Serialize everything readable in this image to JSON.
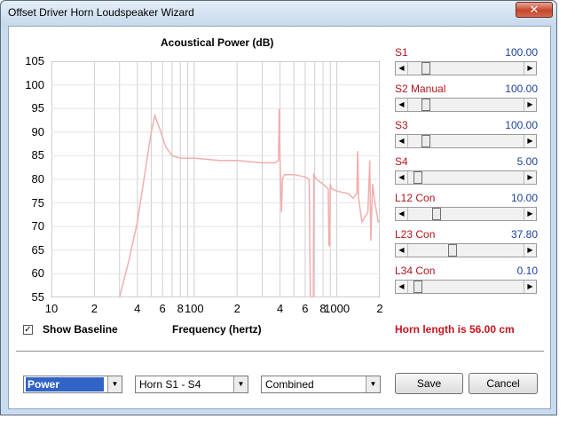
{
  "window": {
    "title": "Offset Driver Horn Loudspeaker Wizard",
    "close_glyph": "✕"
  },
  "chart_data": {
    "type": "line",
    "title": "Acoustical Power (dB)",
    "xlabel": "Frequency (hertz)",
    "ylabel": "",
    "x_scale": "log",
    "xlim": [
      10,
      2000
    ],
    "ylim": [
      55,
      105
    ],
    "yticks": [
      "105",
      "100",
      "95",
      "90",
      "85",
      "80",
      "75",
      "70",
      "65",
      "60",
      "55"
    ],
    "xticks": [
      "10",
      "2",
      "4",
      "6",
      "8",
      "100",
      "2",
      "4",
      "6",
      "8",
      "1000",
      "2"
    ],
    "grid": true,
    "series": [
      {
        "color": "#f2aeae",
        "points": [
          [
            30,
            55
          ],
          [
            35,
            63
          ],
          [
            40,
            71
          ],
          [
            45,
            81
          ],
          [
            50,
            90
          ],
          [
            53,
            93.5
          ],
          [
            57,
            91
          ],
          [
            63,
            87
          ],
          [
            70,
            85
          ],
          [
            80,
            84.5
          ],
          [
            100,
            84.5
          ],
          [
            150,
            84
          ],
          [
            200,
            84
          ],
          [
            300,
            83.5
          ],
          [
            370,
            83.5
          ],
          [
            390,
            84
          ],
          [
            395,
            95
          ],
          [
            400,
            84
          ],
          [
            405,
            77
          ],
          [
            410,
            73
          ],
          [
            415,
            80
          ],
          [
            430,
            81
          ],
          [
            500,
            81
          ],
          [
            600,
            80.5
          ],
          [
            640,
            80
          ],
          [
            660,
            40
          ],
          [
            680,
            40
          ],
          [
            690,
            81
          ],
          [
            720,
            80
          ],
          [
            800,
            79
          ],
          [
            870,
            78
          ],
          [
            880,
            66
          ],
          [
            890,
            66
          ],
          [
            900,
            79
          ],
          [
            920,
            78
          ],
          [
            1000,
            77.5
          ],
          [
            1200,
            77
          ],
          [
            1300,
            76
          ],
          [
            1380,
            77
          ],
          [
            1400,
            86
          ],
          [
            1420,
            76
          ],
          [
            1500,
            71
          ],
          [
            1650,
            73
          ],
          [
            1700,
            84
          ],
          [
            1730,
            67
          ],
          [
            1780,
            79
          ],
          [
            1850,
            75
          ],
          [
            1950,
            71
          ],
          [
            2000,
            71
          ]
        ]
      }
    ]
  },
  "show_baseline": {
    "label": "Show Baseline",
    "checked": true,
    "check_glyph": "✓"
  },
  "sliders": [
    {
      "label": "S1",
      "value": "100.00",
      "position": 0.12
    },
    {
      "label": "S2  Manual",
      "value": "100.00",
      "position": 0.12
    },
    {
      "label": "S3",
      "value": "100.00",
      "position": 0.12
    },
    {
      "label": "S4",
      "value": "5.00",
      "position": 0.04
    },
    {
      "label": "L12  Con",
      "value": "10.00",
      "position": 0.22
    },
    {
      "label": "L23  Con",
      "value": "37.80",
      "position": 0.37
    },
    {
      "label": "L34  Con",
      "value": "0.10",
      "position": 0.04
    }
  ],
  "arrows": {
    "left": "◀",
    "right": "▶",
    "down": "▼"
  },
  "horn_length": "Horn length is 56.00 cm",
  "dropdowns": {
    "mode": "Power",
    "section": "Horn S1 - S4",
    "combination": "Combined"
  },
  "buttons": {
    "save": "Save",
    "cancel": "Cancel"
  }
}
